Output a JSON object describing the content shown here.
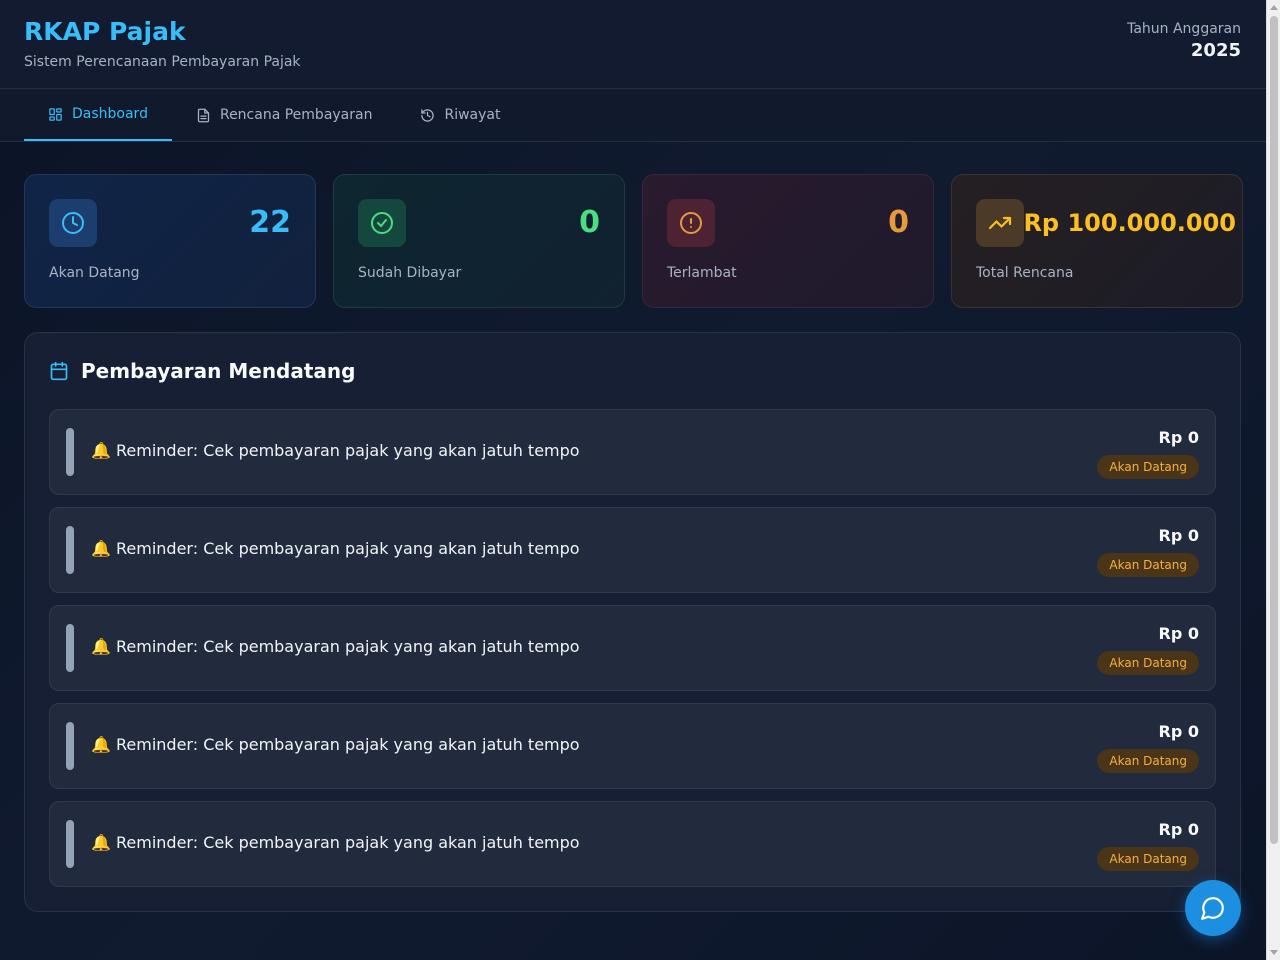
{
  "header": {
    "title": "RKAP Pajak",
    "subtitle": "Sistem Perencanaan Pembayaran Pajak",
    "year_label": "Tahun Anggaran",
    "year_value": "2025"
  },
  "tabs": [
    {
      "label": "Dashboard",
      "icon": "dashboard-icon",
      "active": true
    },
    {
      "label": "Rencana Pembayaran",
      "icon": "document-icon",
      "active": false
    },
    {
      "label": "Riwayat",
      "icon": "history-icon",
      "active": false
    }
  ],
  "stats": [
    {
      "value": "22",
      "label": "Akan Datang",
      "icon": "clock-icon",
      "color": "#38bdf8"
    },
    {
      "value": "0",
      "label": "Sudah Dibayar",
      "icon": "check-circle-icon",
      "color": "#4ade80"
    },
    {
      "value": "0",
      "label": "Terlambat",
      "icon": "alert-circle-icon",
      "color": "#e79a3b"
    },
    {
      "value": "Rp 100.000.000",
      "label": "Total Rencana",
      "icon": "trending-up-icon",
      "color": "#fbbf24"
    }
  ],
  "upcoming": {
    "title": "Pembayaran Mendatang",
    "items": [
      {
        "text": "🔔 Reminder: Cek pembayaran pajak yang akan jatuh tempo",
        "amount": "Rp 0",
        "status": "Akan Datang"
      },
      {
        "text": "🔔 Reminder: Cek pembayaran pajak yang akan jatuh tempo",
        "amount": "Rp 0",
        "status": "Akan Datang"
      },
      {
        "text": "🔔 Reminder: Cek pembayaran pajak yang akan jatuh tempo",
        "amount": "Rp 0",
        "status": "Akan Datang"
      },
      {
        "text": "🔔 Reminder: Cek pembayaran pajak yang akan jatuh tempo",
        "amount": "Rp 0",
        "status": "Akan Datang"
      },
      {
        "text": "🔔 Reminder: Cek pembayaran pajak yang akan jatuh tempo",
        "amount": "Rp 0",
        "status": "Akan Datang"
      }
    ]
  },
  "colors": {
    "accent": "#38bdf8",
    "badge_bg": "#4a3519",
    "badge_text": "#f5b040",
    "fab": "#1d8fe0"
  },
  "chat_button": {
    "icon": "chat-bubble-icon"
  }
}
